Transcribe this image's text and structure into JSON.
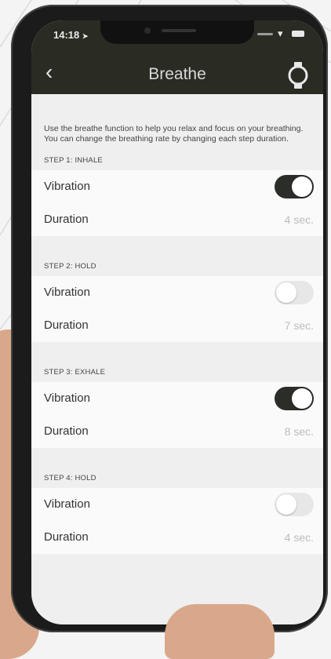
{
  "status": {
    "time": "14:18",
    "location_glyph": "➤"
  },
  "nav": {
    "back_icon": "chevron-left-icon",
    "title": "Breathe",
    "watch_icon": "watch-icon"
  },
  "intro": "Use the breathe function to help you relax and focus on your breathing. You can change the breathing rate by changing each step duration.",
  "steps": [
    {
      "label": "STEP 1: INHALE",
      "vibration_label": "Vibration",
      "vibration_on": true,
      "duration_label": "Duration",
      "duration": "4 sec."
    },
    {
      "label": "STEP 2: HOLD",
      "vibration_label": "Vibration",
      "vibration_on": false,
      "duration_label": "Duration",
      "duration": "7 sec."
    },
    {
      "label": "STEP 3: EXHALE",
      "vibration_label": "Vibration",
      "vibration_on": true,
      "duration_label": "Duration",
      "duration": "8 sec."
    },
    {
      "label": "STEP 4: HOLD",
      "vibration_label": "Vibration",
      "vibration_on": false,
      "duration_label": "Duration",
      "duration": "4 sec."
    }
  ],
  "colors": {
    "header_bg": "#2a2c24",
    "toggle_on": "#2b2d28",
    "toggle_off": "#e7e7e7"
  }
}
